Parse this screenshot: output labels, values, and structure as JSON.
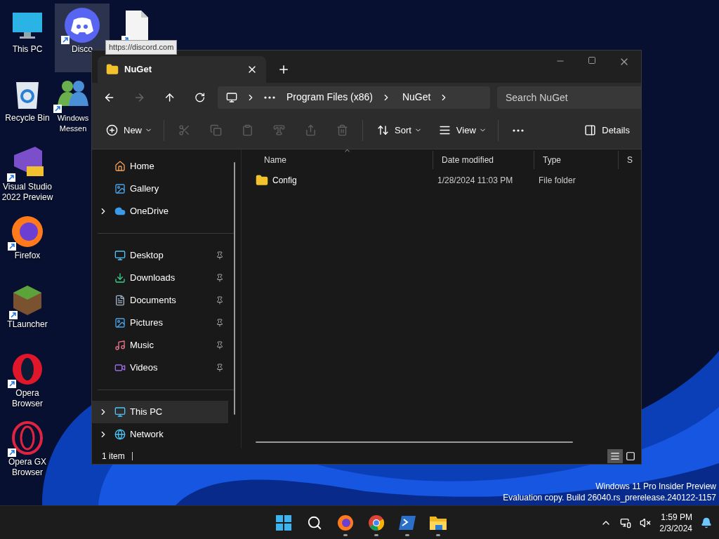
{
  "desktop_columns": [
    [
      {
        "label": "This PC",
        "kind": "monitor",
        "shortcut": false,
        "selected": false
      },
      {
        "label": "Recycle Bin",
        "kind": "recycle",
        "shortcut": false,
        "selected": false
      },
      {
        "label": "Visual Studio 2022 Preview",
        "kind": "visualstudio",
        "shortcut": true,
        "selected": false
      },
      {
        "label": "Firefox",
        "kind": "firefox",
        "shortcut": true,
        "selected": false
      },
      {
        "label": "TLauncher",
        "kind": "minecraft",
        "shortcut": true,
        "selected": false
      },
      {
        "label": "Opera Browser",
        "kind": "opera",
        "shortcut": true,
        "selected": false
      },
      {
        "label": "Opera GX Browser",
        "kind": "operagx",
        "shortcut": true,
        "selected": false
      }
    ],
    [
      {
        "label": "Disco",
        "kind": "discord",
        "shortcut": true,
        "selected": true
      },
      {
        "label": "Windows Messen",
        "kind": "messenger",
        "shortcut": true,
        "selected": false
      }
    ],
    [
      {
        "kind": "document",
        "shortcut": true,
        "selected": false
      }
    ]
  ],
  "tooltip": "https://discord.com",
  "explorer": {
    "tab": "NuGet",
    "breadcrumb": [
      "Program Files (x86)",
      "NuGet"
    ],
    "search": {
      "placeholder": "Search NuGet"
    },
    "toolbar": [
      {
        "kind": "new",
        "label": "New",
        "disabled": false
      },
      {
        "kind": "cut",
        "disabled": true
      },
      {
        "kind": "copy",
        "disabled": true
      },
      {
        "kind": "paste",
        "disabled": true
      },
      {
        "kind": "rename",
        "disabled": true
      },
      {
        "kind": "share",
        "disabled": true
      },
      {
        "kind": "delete",
        "disabled": true
      },
      {
        "kind": "sort",
        "label": "Sort",
        "disabled": false
      },
      {
        "kind": "view",
        "label": "View",
        "disabled": false
      },
      {
        "kind": "more",
        "disabled": false
      }
    ],
    "details_button": "Details",
    "sidebar": [
      [
        {
          "label": "Home",
          "kind": "home",
          "expandable": false,
          "pinned": false,
          "selected": false
        },
        {
          "label": "Gallery",
          "kind": "gallery",
          "expandable": false,
          "pinned": false,
          "selected": false
        },
        {
          "label": "OneDrive",
          "kind": "cloud",
          "expandable": true,
          "pinned": false,
          "selected": false
        }
      ],
      [
        {
          "label": "Desktop",
          "kind": "desktop",
          "expandable": false,
          "pinned": true,
          "selected": false
        },
        {
          "label": "Downloads",
          "kind": "downloads",
          "expandable": false,
          "pinned": true,
          "selected": false
        },
        {
          "label": "Documents",
          "kind": "documents",
          "expandable": false,
          "pinned": true,
          "selected": false
        },
        {
          "label": "Pictures",
          "kind": "pictures",
          "expandable": false,
          "pinned": true,
          "selected": false
        },
        {
          "label": "Music",
          "kind": "music",
          "expandable": false,
          "pinned": true,
          "selected": false
        },
        {
          "label": "Videos",
          "kind": "videos",
          "expandable": false,
          "pinned": true,
          "selected": false
        }
      ],
      [
        {
          "label": "This PC",
          "kind": "pc",
          "expandable": true,
          "pinned": false,
          "selected": true
        },
        {
          "label": "Network",
          "kind": "network",
          "expandable": true,
          "pinned": false,
          "selected": false
        }
      ]
    ],
    "columns": [
      "Name",
      "Date modified",
      "Type",
      "S"
    ],
    "rows": [
      {
        "cells": [
          "Config",
          "1/28/2024 11:03 PM",
          "File folder"
        ],
        "selected": false
      }
    ],
    "status": "1 item",
    "view_modes": [
      {
        "kind": "details",
        "selected": true
      },
      {
        "kind": "tiles",
        "selected": false
      }
    ]
  },
  "watermark": [
    "Windows 11 Pro Insider Preview",
    "Evaluation copy. Build 26040.rs_prerelease.240122-1157"
  ],
  "taskbar": {
    "apps": [
      {
        "kind": "start",
        "running": false
      },
      {
        "kind": "search",
        "running": false
      },
      {
        "kind": "firefox",
        "running": true
      },
      {
        "kind": "chrome",
        "running": true
      },
      {
        "kind": "terminal",
        "running": true
      },
      {
        "kind": "explorer",
        "running": true
      }
    ],
    "time": "1:59 PM",
    "date": "2/3/2024"
  }
}
